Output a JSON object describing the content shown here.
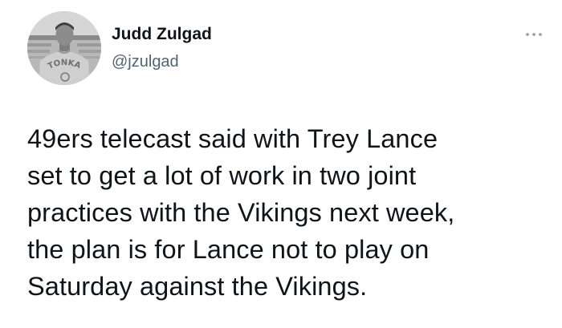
{
  "user": {
    "display_name": "Judd Zulgad",
    "handle": "@jzulgad",
    "avatar_icon": "user-avatar-photo",
    "avatar_shirt_text": "TONKA"
  },
  "tweet": {
    "text": "49ers telecast said with Trey Lance\nset to get a lot of work in two joint\npractices with the Vikings next week,\nthe plan is for Lance not to play on\nSaturday against the Vikings."
  },
  "icons": {
    "more": "more-options-icon"
  },
  "colors": {
    "text_primary": "#0f1419",
    "text_secondary": "#536471",
    "background": "#ffffff"
  }
}
